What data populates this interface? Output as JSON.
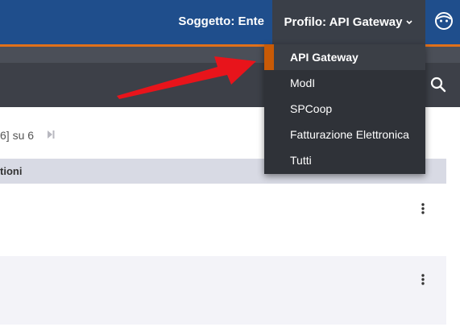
{
  "header": {
    "soggetto_label": "Soggetto: Ente",
    "profilo_label": "Profilo: API Gateway"
  },
  "profile_menu": {
    "items": [
      {
        "label": "API Gateway",
        "active": true
      },
      {
        "label": "ModI",
        "active": false
      },
      {
        "label": "SPCoop",
        "active": false
      },
      {
        "label": "Fatturazione Elettronica",
        "active": false
      },
      {
        "label": "Tutti",
        "active": false
      }
    ]
  },
  "pagination": {
    "text": "6] su 6"
  },
  "table": {
    "header_label": "tioni"
  },
  "colors": {
    "header_bg": "#1f4e8c",
    "accent_orange": "#c85a06",
    "menu_bg": "#2f3238",
    "annotation_arrow": "#e8141b"
  },
  "icons": {
    "user": "user-avatar-icon",
    "chevron": "chevron-down-icon",
    "search": "search-icon",
    "last_page": "last-page-icon",
    "row_menu": "kebab-menu-icon"
  }
}
